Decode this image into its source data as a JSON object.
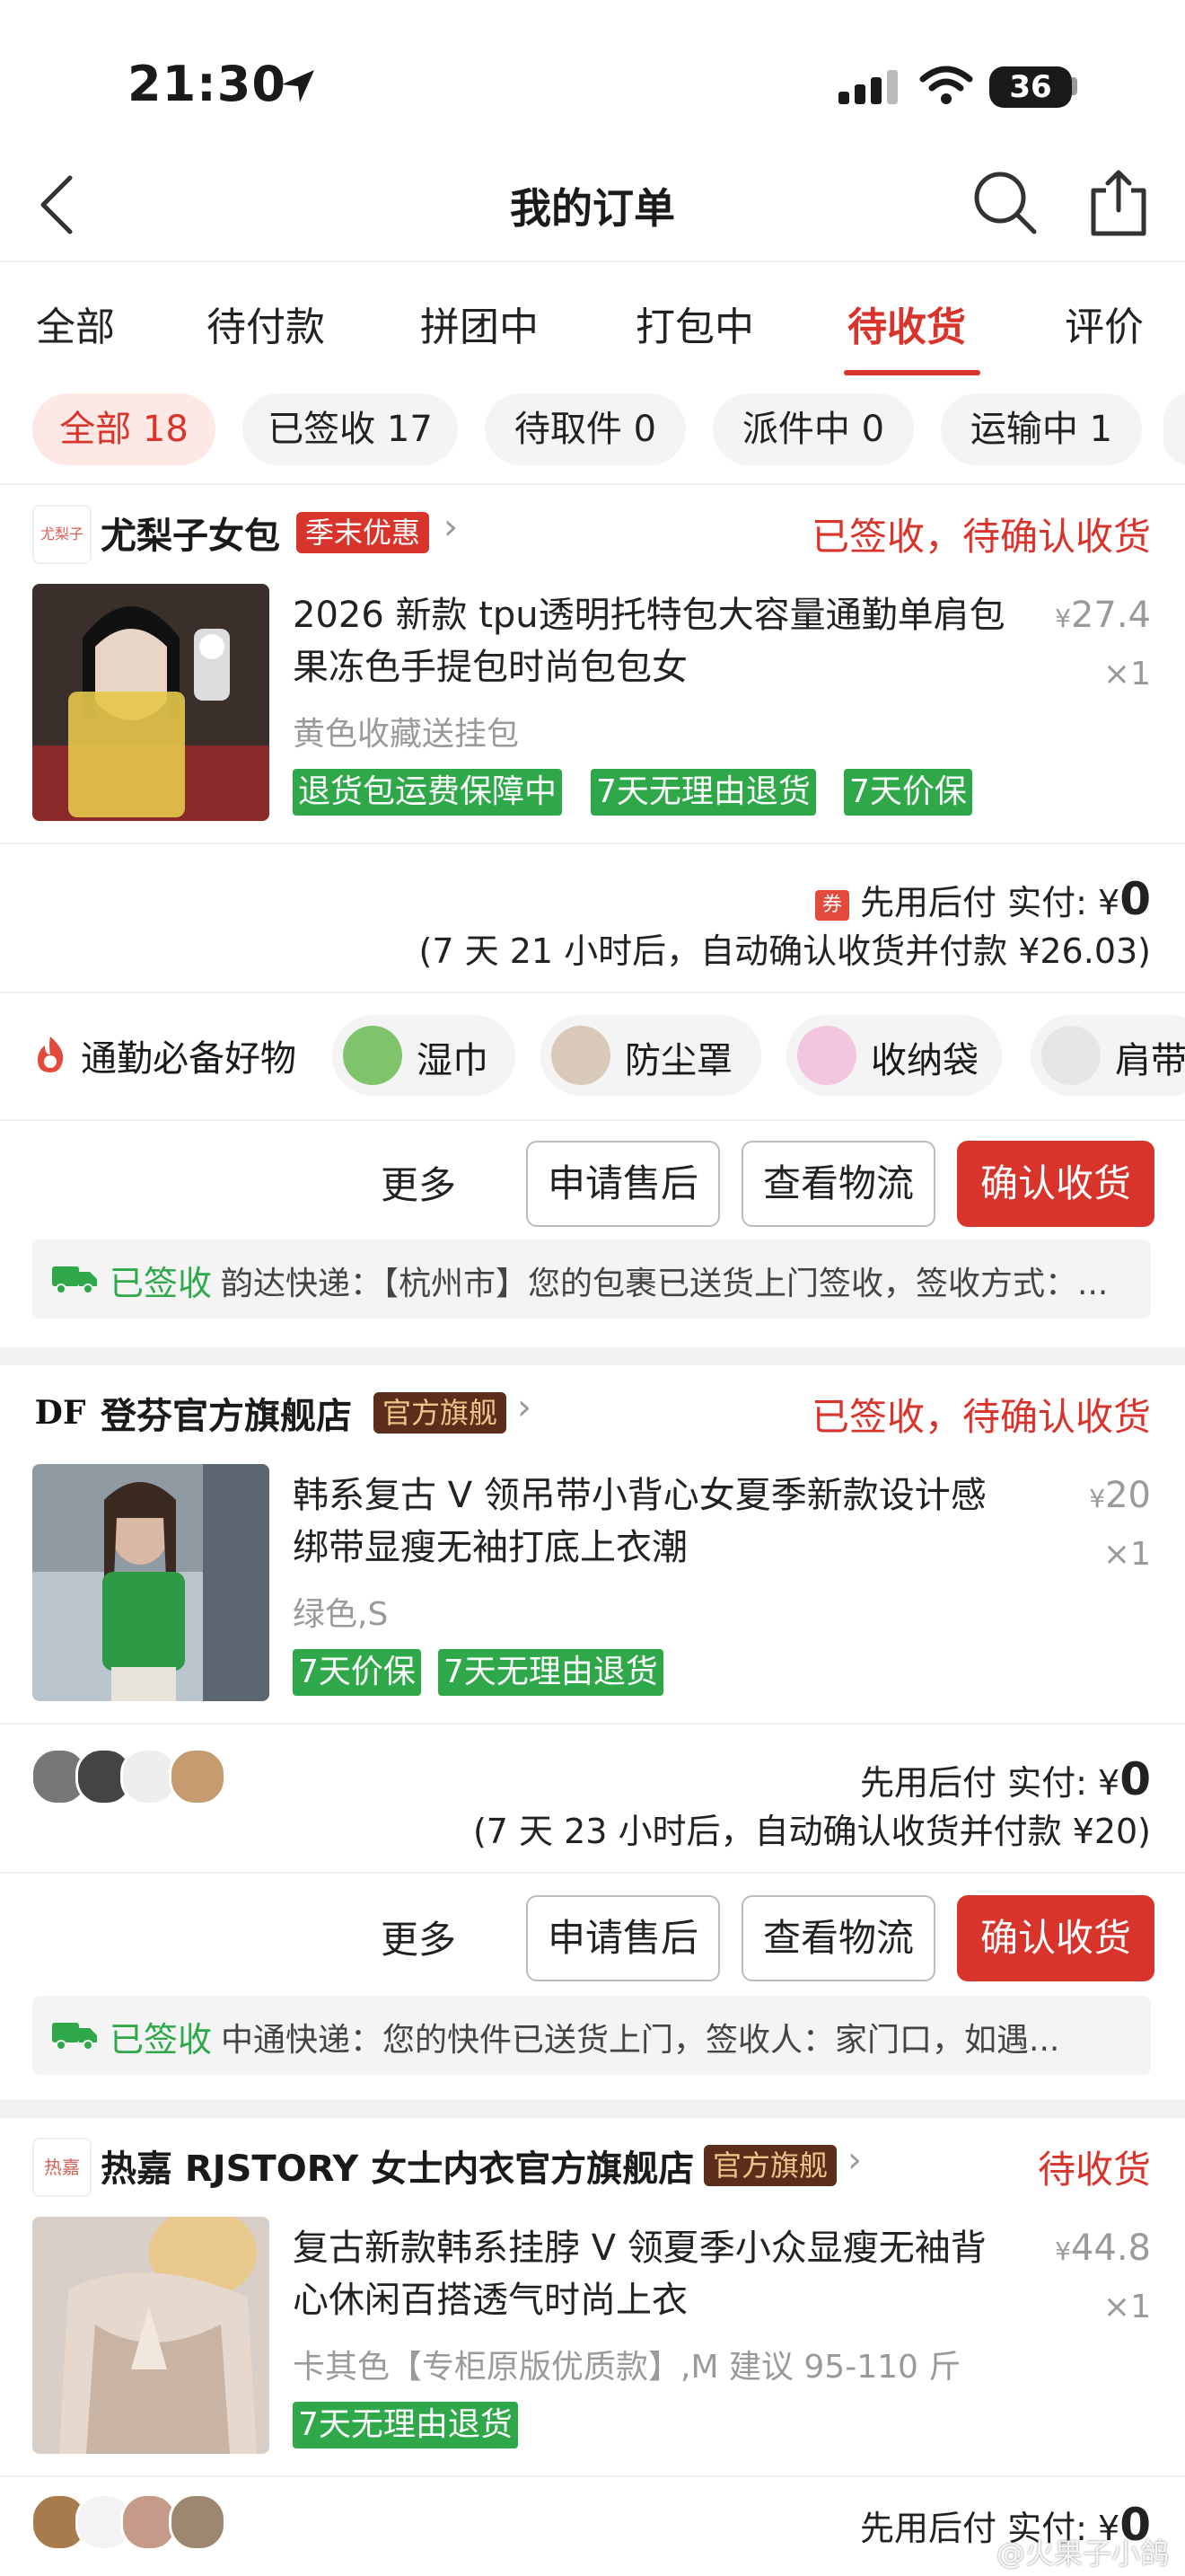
{
  "status_bar": {
    "time": "21:30",
    "battery": "36"
  },
  "nav": {
    "title": "我的订单"
  },
  "tabs": [
    {
      "label": "全部"
    },
    {
      "label": "待付款"
    },
    {
      "label": "拼团中"
    },
    {
      "label": "打包中"
    },
    {
      "label": "待收货"
    },
    {
      "label": "评价"
    }
  ],
  "chips": [
    {
      "label": "全部 18"
    },
    {
      "label": "已签收 17"
    },
    {
      "label": "待取件 0"
    },
    {
      "label": "派件中 0"
    },
    {
      "label": "运输中 1"
    }
  ],
  "orders": [
    {
      "shop": "尤梨子女包",
      "shop_logo_text": "尤梨子",
      "shop_badge": "季末优惠",
      "status": "已签收，待确认收货",
      "title": "2026 新款 tpu透明托特包大容量通勤单肩包果冻色手提包时尚包包女",
      "price_symbol": "¥",
      "price": "27.4",
      "qty": "×1",
      "variant": "黄色收藏送挂包",
      "tags": [
        "退货包运费保障中",
        "7天无理由退货",
        "7天价保"
      ],
      "coupon_icon": "券",
      "pay_label": "先用后付 实付:",
      "pay_symbol": "¥",
      "pay_value": "0",
      "auto_note": "(7 天 21 小时后，自动确认收货并付款 ¥26.03)",
      "more": "更多",
      "btn_after_sale": "申请售后",
      "btn_logistics": "查看物流",
      "btn_confirm": "确认收货",
      "track_status": "已签收",
      "track_info": "韵达快递：【杭州市】您的包裹已送货上门签收，签收方式：..."
    },
    {
      "shop": "登芬官方旗舰店",
      "shop_logo_text": "DF",
      "shop_badge": "官方旗舰",
      "status": "已签收，待确认收货",
      "title": "韩系复古 V 领吊带小背心女夏季新款设计感绑带显瘦无袖打底上衣潮",
      "price_symbol": "¥",
      "price": "20",
      "qty": "×1",
      "variant": "绿色,S",
      "tags": [
        "7天价保",
        "7天无理由退货"
      ],
      "pay_label": "先用后付 实付:",
      "pay_symbol": "¥",
      "pay_value": "0",
      "auto_note": "(7 天 23 小时后，自动确认收货并付款 ¥20)",
      "more": "更多",
      "btn_after_sale": "申请售后",
      "btn_logistics": "查看物流",
      "btn_confirm": "确认收货",
      "track_status": "已签收",
      "track_info": "中通快递：您的快件已送货上门，签收人：家门口，如遇..."
    },
    {
      "shop": "热嘉 RJSTORY 女士内衣官方旗舰店",
      "shop_logo_text": "热嘉",
      "shop_badge": "官方旗舰",
      "status": "待收货",
      "title": "复古新款韩系挂脖 V 领夏季小众显瘦无袖背心休闲百搭透气时尚上衣",
      "price_symbol": "¥",
      "price": "44.8",
      "qty": "×1",
      "variant": "卡其色【专柜原版优质款】,M 建议 95-110 斤",
      "tags": [
        "7天无理由退货"
      ],
      "pay_label": "先用后付 实付:",
      "pay_symbol": "¥",
      "pay_value": "0"
    }
  ],
  "recommend": {
    "title": "通勤必备好物",
    "items": [
      {
        "label": "湿巾"
      },
      {
        "label": "防尘罩"
      },
      {
        "label": "收纳袋"
      },
      {
        "label": "肩带"
      }
    ]
  },
  "watermark": "@火果子小鸽",
  "colors": {
    "accent": "#d9342b",
    "green": "#2fa84a"
  }
}
